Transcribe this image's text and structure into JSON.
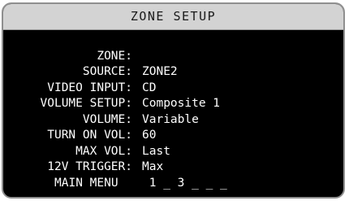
{
  "screen": {
    "title": "ZONE SETUP",
    "rows": [
      {
        "label": "ZONE:",
        "value": "ZONE2"
      },
      {
        "label": "SOURCE:",
        "value": "CD"
      },
      {
        "label": "VIDEO INPUT:",
        "value": "Composite 1"
      },
      {
        "label": "VOLUME SETUP:",
        "value": "Variable"
      },
      {
        "label": "VOLUME:",
        "value": "60"
      },
      {
        "label": "TURN ON VOL:",
        "value": "Last"
      },
      {
        "label": "MAX VOL:",
        "value": "Max"
      },
      {
        "label": "12V TRIGGER:",
        "value": " 1 _ 3 _ _ _"
      }
    ],
    "menu_item": "MAIN MENU"
  },
  "colors": {
    "screen_background": "#000000",
    "title_bar": "#d3d3d3",
    "text": "#ffffff",
    "border": "#8f8f8f"
  }
}
